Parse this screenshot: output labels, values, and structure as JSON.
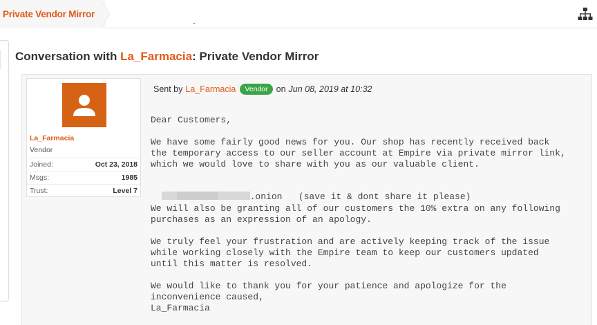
{
  "breadcrumb": {
    "label": "Private Vendor Mirror",
    "sitemap_icon": "sitemap-icon"
  },
  "title": {
    "prefix": "Conversation with ",
    "vendor": "La_Farmacia",
    "suffix": ": Private Vendor Mirror"
  },
  "user_card": {
    "name": "La_Farmacia",
    "role": "Vendor",
    "avatar_icon": "user-icon",
    "avatar_color": "#d66216",
    "stats": [
      {
        "label": "Joined:",
        "value": "Oct 23, 2018"
      },
      {
        "label": "Msgs:",
        "value": "1985"
      },
      {
        "label": "Trust:",
        "value": "Level 7"
      }
    ]
  },
  "message": {
    "sent_by_label": "Sent by",
    "sender": "La_Farmacia",
    "badge": "Vendor",
    "badge_color": "#3aa547",
    "on_label": "on",
    "date": "Jun 08, 2019 at 10:32",
    "greeting": "Dear Customers,",
    "p1": [
      "We have some fairly good news for you. Our shop has recently received back",
      "the temporary access to our seller account at Empire via private mirror link,",
      "which we would love to share with you as our valuable client."
    ],
    "link_suffix": ".onion   (save it & dont share it please)",
    "p2": [
      "We will also be granting all of our customers the 10% extra on any following",
      "purchases as an expression of an apology."
    ],
    "p3": [
      "We truly feel your frustration and are actively keeping track of the issue",
      "while working closely with the Empire team to keep our customers updated",
      "until this matter is resolved."
    ],
    "p4": [
      "We would like to thank you for your patience and apologize for the",
      "inconvenience caused,",
      "La_Farmacia"
    ]
  },
  "colors": {
    "accent": "#e05a1b",
    "panel_bg": "#f7f7f7"
  }
}
